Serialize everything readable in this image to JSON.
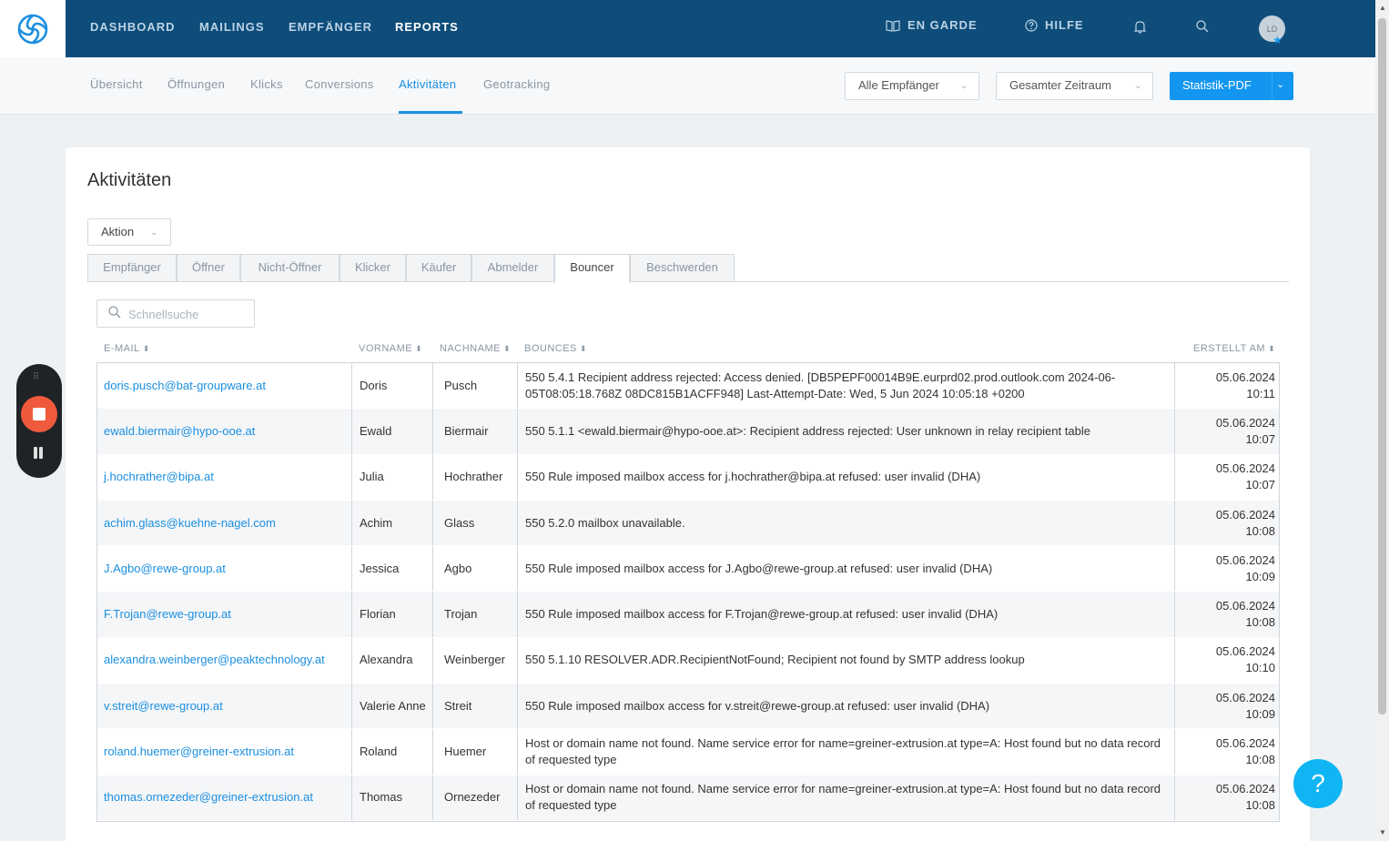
{
  "nav": {
    "items": [
      "DASHBOARD",
      "MAILINGS",
      "EMPFÄNGER",
      "REPORTS"
    ],
    "en_garde": "EN GARDE",
    "hilfe": "HILFE",
    "avatar_initials": "LD"
  },
  "subnav": {
    "items": [
      "Übersicht",
      "Öffnungen",
      "Klicks",
      "Conversions",
      "Aktivitäten",
      "Geotracking"
    ],
    "recipients_select": "Alle Empfänger",
    "period_select": "Gesamter Zeitraum",
    "pdf_button": "Statistik-PDF"
  },
  "card": {
    "title": "Aktivitäten",
    "action_button": "Aktion",
    "tabs": [
      "Empfänger",
      "Öffner",
      "Nicht-Öffner",
      "Klicker",
      "Käufer",
      "Abmelder",
      "Bouncer",
      "Beschwerden"
    ],
    "search_placeholder": "Schnellsuche"
  },
  "table": {
    "headers": [
      "E-MAIL",
      "VORNAME",
      "NACHNAME",
      "BOUNCES",
      "ERSTELLT AM"
    ],
    "rows": [
      {
        "email": "doris.pusch@bat-groupware.at",
        "first": "Doris",
        "last": "Pusch",
        "bounce": "550 5.4.1 Recipient address rejected: Access denied. [DB5PEPF00014B9E.eurprd02.prod.outlook.com 2024-06-05T08:05:18.768Z 08DC815B1ACFF948] Last-Attempt-Date: Wed, 5 Jun 2024 10:05:18 +0200",
        "date": "05.06.2024",
        "time": "10:11"
      },
      {
        "email": "ewald.biermair@hypo-ooe.at",
        "first": "Ewald",
        "last": "Biermair",
        "bounce": "550 5.1.1 <ewald.biermair@hypo-ooe.at>: Recipient address rejected: User unknown in relay recipient table",
        "date": "05.06.2024",
        "time": "10:07"
      },
      {
        "email": "j.hochrather@bipa.at",
        "first": "Julia",
        "last": "Hochrather",
        "bounce": "550 Rule imposed mailbox access for j.hochrather@bipa.at refused: user invalid (DHA)",
        "date": "05.06.2024",
        "time": "10:07"
      },
      {
        "email": "achim.glass@kuehne-nagel.com",
        "first": "Achim",
        "last": "Glass",
        "bounce": "550 5.2.0 mailbox unavailable.",
        "date": "05.06.2024",
        "time": "10:08"
      },
      {
        "email": "J.Agbo@rewe-group.at",
        "first": "Jessica",
        "last": "Agbo",
        "bounce": "550 Rule imposed mailbox access for J.Agbo@rewe-group.at refused: user invalid (DHA)",
        "date": "05.06.2024",
        "time": "10:09"
      },
      {
        "email": "F.Trojan@rewe-group.at",
        "first": "Florian",
        "last": "Trojan",
        "bounce": "550 Rule imposed mailbox access for F.Trojan@rewe-group.at refused: user invalid (DHA)",
        "date": "05.06.2024",
        "time": "10:08"
      },
      {
        "email": "alexandra.weinberger@peaktechnology.at",
        "first": "Alexandra",
        "last": "Weinberger",
        "bounce": "550 5.1.10 RESOLVER.ADR.RecipientNotFound; Recipient not found by SMTP address lookup",
        "date": "05.06.2024",
        "time": "10:10"
      },
      {
        "email": "v.streit@rewe-group.at",
        "first": "Valerie Anne",
        "last": "Streit",
        "bounce": "550 Rule imposed mailbox access for v.streit@rewe-group.at refused: user invalid (DHA)",
        "date": "05.06.2024",
        "time": "10:09"
      },
      {
        "email": "roland.huemer@greiner-extrusion.at",
        "first": "Roland",
        "last": "Huemer",
        "bounce": "Host or domain name not found. Name service error for name=greiner-extrusion.at type=A: Host found but no data record of requested type",
        "date": "05.06.2024",
        "time": "10:08"
      },
      {
        "email": "thomas.ornezeder@greiner-extrusion.at",
        "first": "Thomas",
        "last": "Ornezeder",
        "bounce": "Host or domain name not found. Name service error for name=greiner-extrusion.at type=A: Host found but no data record of requested type",
        "date": "05.06.2024",
        "time": "10:08"
      }
    ]
  },
  "help_bubble": "?",
  "colors": {
    "nav_bg": "#0e4d7a",
    "accent": "#1b8fe0",
    "pdf_button": "#1296f0",
    "record": "#f05a3c",
    "help": "#10b5f4"
  }
}
